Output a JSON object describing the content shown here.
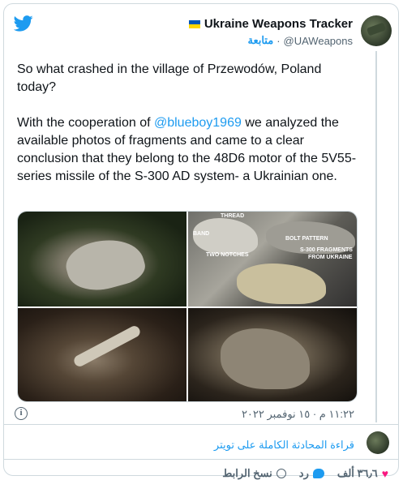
{
  "author": {
    "display_name": "Ukraine Weapons Tracker",
    "handle": "@UAWeapons",
    "follow_label": "متابعة",
    "separator": "·"
  },
  "tweet": {
    "paragraph_1": "So what crashed in the village of Przewodów, Poland today?",
    "paragraph_2_before": "With the cooperation of ",
    "mention": "@blueboy1969",
    "paragraph_2_after": " we analyzed the available photos of fragments and came to a clear conclusion that they belong to the 48D6 motor of the 5V55-series missile of the S-300 AD system- a Ukrainian one."
  },
  "media": {
    "labels": [
      "THREAD",
      "BAND",
      "TWO NOTCHES",
      "BOLT PATTERN",
      "S-300 FRAGMENTS",
      "FROM UKRAINE"
    ]
  },
  "timestamp": "١١:٢٢ م · ١٥ نوفمبر ٢٠٢٢",
  "read_full_label": "قراءة المحادثة الكاملة على تويتر",
  "actions": {
    "likes_count": "٣٦٫٦ ألف",
    "reply_label": "رد",
    "copy_link_label": "نسخ الرابط"
  },
  "colors": {
    "accent": "#1d9bf0",
    "like": "#f91880",
    "muted": "#536471"
  },
  "icons": [
    "twitter-bird-icon",
    "info-icon",
    "heart-icon",
    "reply-bubble-icon",
    "link-icon"
  ]
}
